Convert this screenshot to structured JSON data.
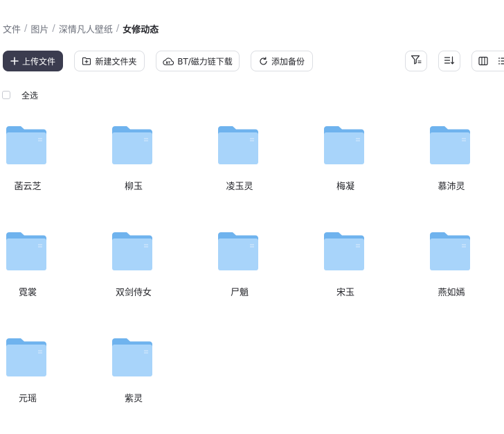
{
  "breadcrumb": {
    "items": [
      "文件",
      "图片",
      "深情凡人壁纸"
    ],
    "current": "女修动态",
    "separator": "/"
  },
  "toolbar": {
    "upload_label": "上传文件",
    "new_folder_label": "新建文件夹",
    "bt_label": "BT/磁力链下载",
    "backup_label": "添加备份"
  },
  "select_all_label": "全选",
  "folders": [
    "菡云芝",
    "柳玉",
    "凌玉灵",
    "梅凝",
    "慕沛灵",
    "霓裳",
    "双剑侍女",
    "尸魈",
    "宋玉",
    "燕如嫣",
    "元瑶",
    "紫灵"
  ],
  "colors": {
    "primary_button": "#3b3c4f",
    "folder_back": "#6fb3ee",
    "folder_front": "#a8d4fa"
  },
  "icons": {
    "upload": "plus-icon",
    "new_folder": "folder-plus-icon",
    "bt": "bt-icon",
    "backup": "refresh-icon",
    "filter": "filter-icon",
    "sort": "sort-icon",
    "view_columns": "columns-icon",
    "view_list": "list-icon"
  }
}
